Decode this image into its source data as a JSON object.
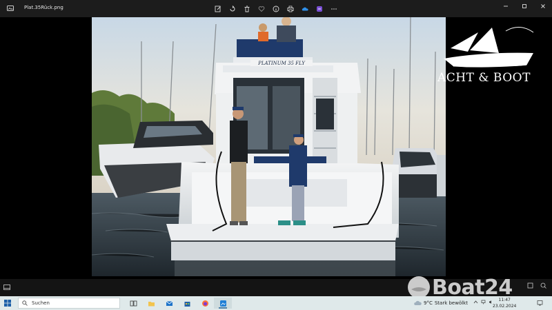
{
  "window": {
    "filename": "Plat.35Rück.png",
    "toolbar_icons": [
      "edit-icon",
      "rotate-icon",
      "delete-icon",
      "favorite-icon",
      "info-icon",
      "print-icon",
      "onedrive-icon",
      "clipchamp-icon",
      "more-icon"
    ],
    "controls": [
      "minimize-icon",
      "maximize-icon",
      "close-icon"
    ]
  },
  "photo": {
    "boat_name": "PLATINUM 35 FLY"
  },
  "watermarks": {
    "yacht_boot": "ACHT & BOOT",
    "boat24": "Boat24"
  },
  "taskbar": {
    "search_placeholder": "Suchen",
    "weather_temp": "9°C",
    "weather_desc": "Stark bewölkt",
    "time": "11:47",
    "date": "23.02.2024"
  },
  "colors": {
    "titlebar": "#1c1c1c",
    "taskbar": "#dfe9ea",
    "accent": "#4a7fa8"
  }
}
